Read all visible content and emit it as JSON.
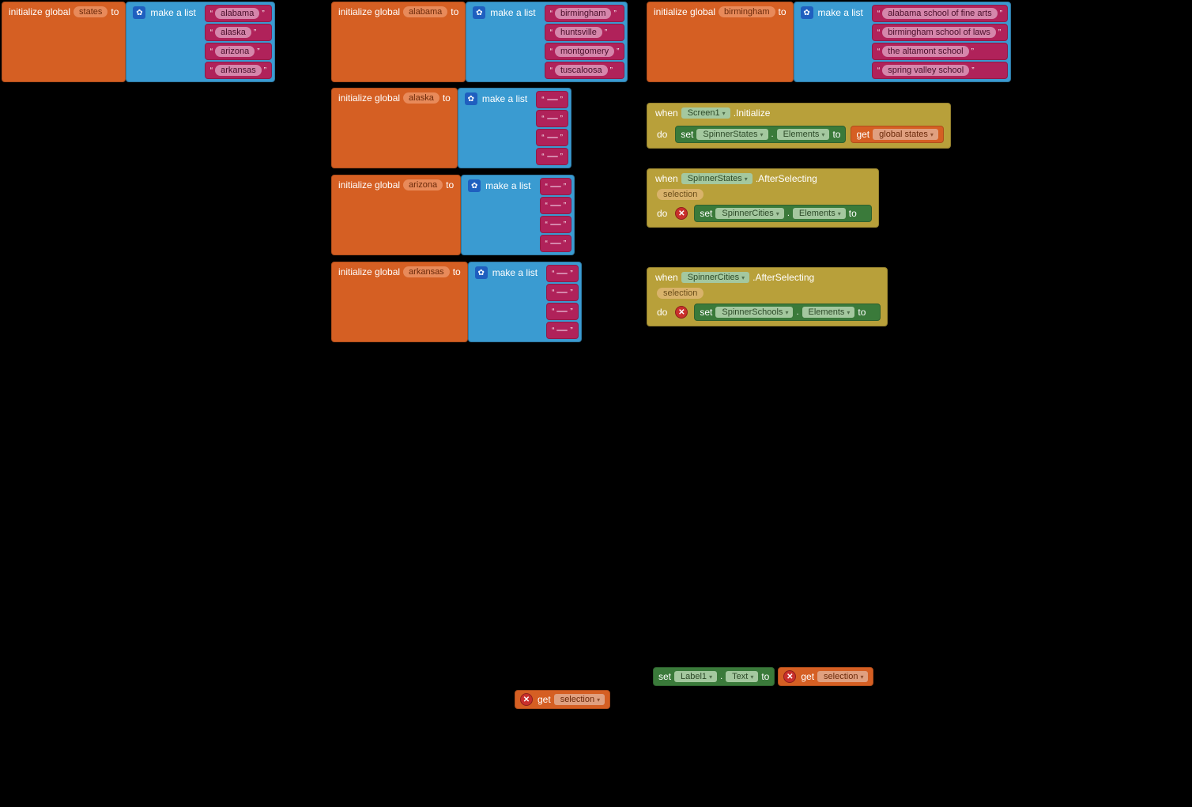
{
  "labels": {
    "init_global": "initialize global",
    "to": "to",
    "make_a_list": "make a list",
    "when": "when",
    "do": "do",
    "set": "set",
    "get": "get",
    "dot": "."
  },
  "vars": {
    "states": {
      "name": "states",
      "items": [
        "alabama",
        "alaska",
        "arizona",
        "arkansas"
      ]
    },
    "alabama": {
      "name": "alabama",
      "items": [
        "birmingham",
        "huntsville",
        "montgomery",
        "tuscaloosa"
      ]
    },
    "birmingham": {
      "name": "birmingham",
      "items": [
        "alabama school of fine arts",
        "birmingham school of laws",
        "the altamont school",
        "spring valley school"
      ]
    },
    "alaska": {
      "name": "alaska",
      "empty_slots": 4
    },
    "arizona": {
      "name": "arizona",
      "empty_slots": 4
    },
    "arkansas": {
      "name": "arkansas",
      "empty_slots": 4
    }
  },
  "events": {
    "screen_init": {
      "component": "Screen1",
      "event": ".Initialize",
      "set_target": "SpinnerStates",
      "set_prop": "Elements",
      "to": "to",
      "get_var": "global states"
    },
    "states_after": {
      "component": "SpinnerStates",
      "event": ".AfterSelecting",
      "param": "selection",
      "set_target": "SpinnerCities",
      "set_prop": "Elements",
      "to": "to"
    },
    "cities_after": {
      "component": "SpinnerCities",
      "event": ".AfterSelecting",
      "param": "selection",
      "set_target": "SpinnerSchools",
      "set_prop": "Elements",
      "to": "to"
    }
  },
  "loose": {
    "set_label": {
      "target": "Label1",
      "prop": "Text",
      "to": "to",
      "get_var": "selection"
    },
    "get_selection": "selection"
  }
}
